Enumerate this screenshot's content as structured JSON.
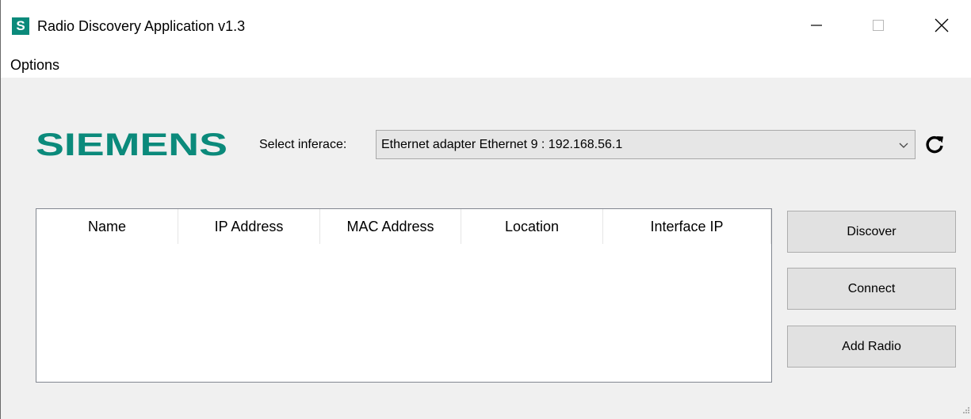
{
  "window": {
    "title": "Radio Discovery Application v1.3",
    "app_icon_letter": "S",
    "app_icon_color": "#0b8a7b"
  },
  "menu": {
    "items": [
      {
        "label": "Options"
      }
    ]
  },
  "logo": {
    "text": "SIEMENS",
    "color": "#0b8a7b"
  },
  "interface": {
    "label": "Select inferace:",
    "selected": "Ethernet adapter Ethernet 9 : 192.168.56.1",
    "refresh_icon": "refresh-icon"
  },
  "device_list": {
    "columns": [
      "Name",
      "IP Address",
      "MAC Address",
      "Location",
      "Interface IP"
    ],
    "rows": []
  },
  "actions": {
    "discover": "Discover",
    "connect": "Connect",
    "add_radio": "Add Radio"
  }
}
